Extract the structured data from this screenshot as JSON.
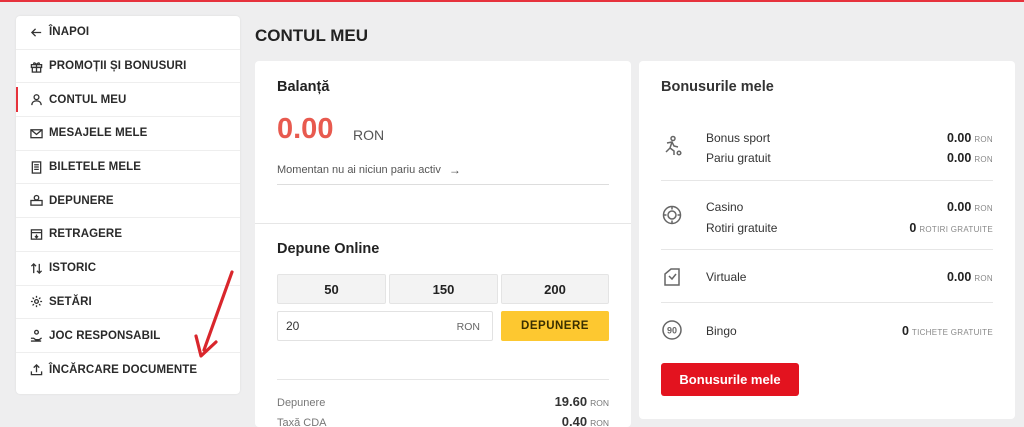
{
  "page": {
    "title": "CONTUL MEU",
    "accent": "#e6323c"
  },
  "sidebar": {
    "items": [
      {
        "label": "ÎNAPOI",
        "icon": "arrow-left-icon"
      },
      {
        "label": "PROMOȚII ȘI BONUSURI",
        "icon": "gift-icon"
      },
      {
        "label": "CONTUL MEU",
        "icon": "user-icon",
        "active": true
      },
      {
        "label": "MESAJELE MELE",
        "icon": "mail-icon"
      },
      {
        "label": "BILETELE MELE",
        "icon": "ticket-icon"
      },
      {
        "label": "DEPUNERE",
        "icon": "cash-icon"
      },
      {
        "label": "RETRAGERE",
        "icon": "withdraw-icon"
      },
      {
        "label": "ISTORIC",
        "icon": "sort-arrows-icon"
      },
      {
        "label": "SETĂRI",
        "icon": "gear-icon"
      },
      {
        "label": "JOC RESPONSABIL",
        "icon": "hand-icon"
      },
      {
        "label": "ÎNCĂRCARE DOCUMENTE",
        "icon": "upload-icon"
      }
    ]
  },
  "balance": {
    "title": "Balanță",
    "amount": "0.00",
    "currency": "RON",
    "message": "Momentan nu ai niciun pariu activ",
    "arrow": "→"
  },
  "deposit": {
    "title": "Depune Online",
    "amounts": [
      "50",
      "150",
      "200"
    ],
    "input_value": "20",
    "input_currency": "RON",
    "button_label": "DEPUNERE",
    "button_color": "#fdc830",
    "summary": [
      {
        "label": "Depunere",
        "value": "19.60",
        "currency": "RON"
      },
      {
        "label": "Taxă CDA",
        "value": "0.40",
        "currency": "RON"
      }
    ]
  },
  "bonuses": {
    "title": "Bonusurile mele",
    "groups": [
      {
        "icon": "sport-runner-icon",
        "rows": [
          {
            "label": "Bonus sport",
            "value": "0.00",
            "unit": "RON"
          },
          {
            "label": "Pariu gratuit",
            "value": "0.00",
            "unit": "RON"
          }
        ]
      },
      {
        "icon": "casino-chip-icon",
        "rows": [
          {
            "label": "Casino",
            "value": "0.00",
            "unit": "RON"
          },
          {
            "label": "Rotiri gratuite",
            "value": "0",
            "unit": "ROTIRI GRATUITE"
          }
        ]
      },
      {
        "icon": "virtual-icon",
        "rows": [
          {
            "label": "Virtuale",
            "value": "0.00",
            "unit": "RON"
          }
        ]
      },
      {
        "icon": "bingo-90-icon",
        "icon_text": "90",
        "rows": [
          {
            "label": "Bingo",
            "value": "0",
            "unit": "TICHETE GRATUITE"
          }
        ]
      }
    ],
    "button_label": "Bonusurile mele",
    "button_color": "#e3131f"
  }
}
